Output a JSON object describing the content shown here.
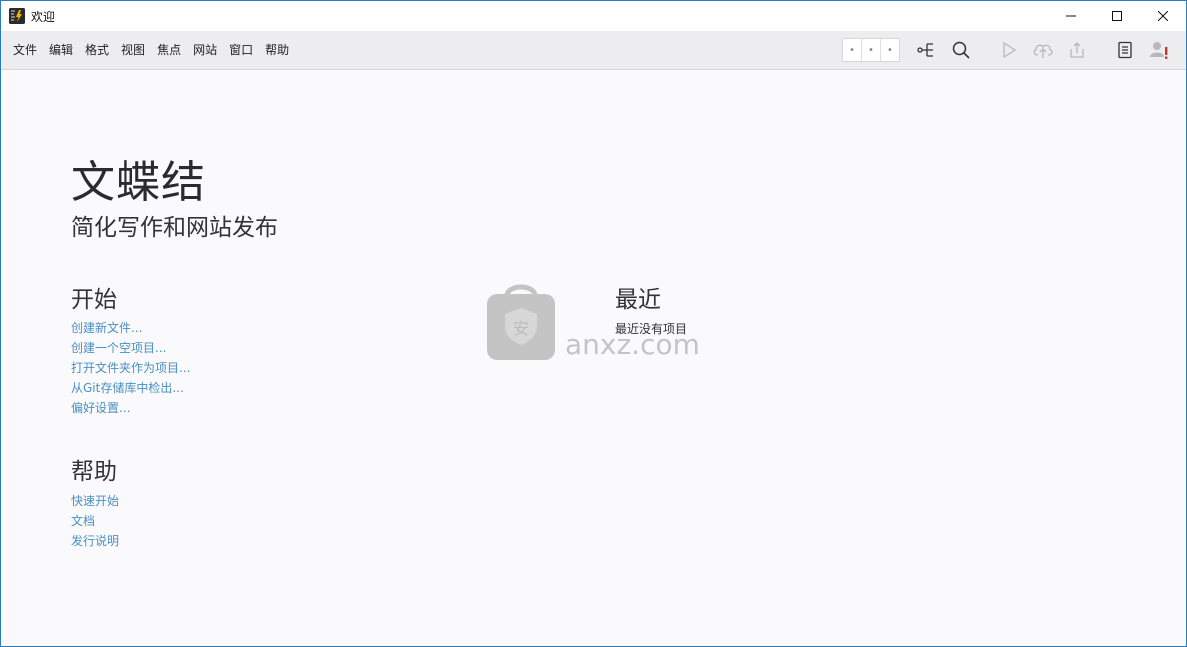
{
  "window": {
    "title": "欢迎"
  },
  "menu": {
    "items": [
      "文件",
      "编辑",
      "格式",
      "视图",
      "焦点",
      "网站",
      "窗口",
      "帮助"
    ]
  },
  "toolbar": {
    "dots": [
      "•",
      "•",
      "•"
    ],
    "icons": [
      "sitemap-icon",
      "search-icon",
      "play-icon",
      "upload-cloud-icon",
      "share-icon",
      "document-icon",
      "user-warning-icon"
    ]
  },
  "main": {
    "app_name": "文蝶结",
    "tagline": "简化写作和网站发布",
    "start": {
      "heading": "开始",
      "links": [
        "创建新文件...",
        "创建一个空项目...",
        "打开文件夹作为项目...",
        "从Git存储库中检出...",
        "偏好设置..."
      ]
    },
    "help": {
      "heading": "帮助",
      "links": [
        "快速开始",
        "文档",
        "发行说明"
      ]
    },
    "recent": {
      "heading": "最近",
      "empty_text": "最近没有项目"
    }
  },
  "watermark": {
    "text": "anxz.com",
    "glyph": "安"
  },
  "colors": {
    "link": "#4a90c2",
    "border": "#2a7bbf",
    "background": "#faf9fb",
    "toolbar": "#ededef"
  }
}
